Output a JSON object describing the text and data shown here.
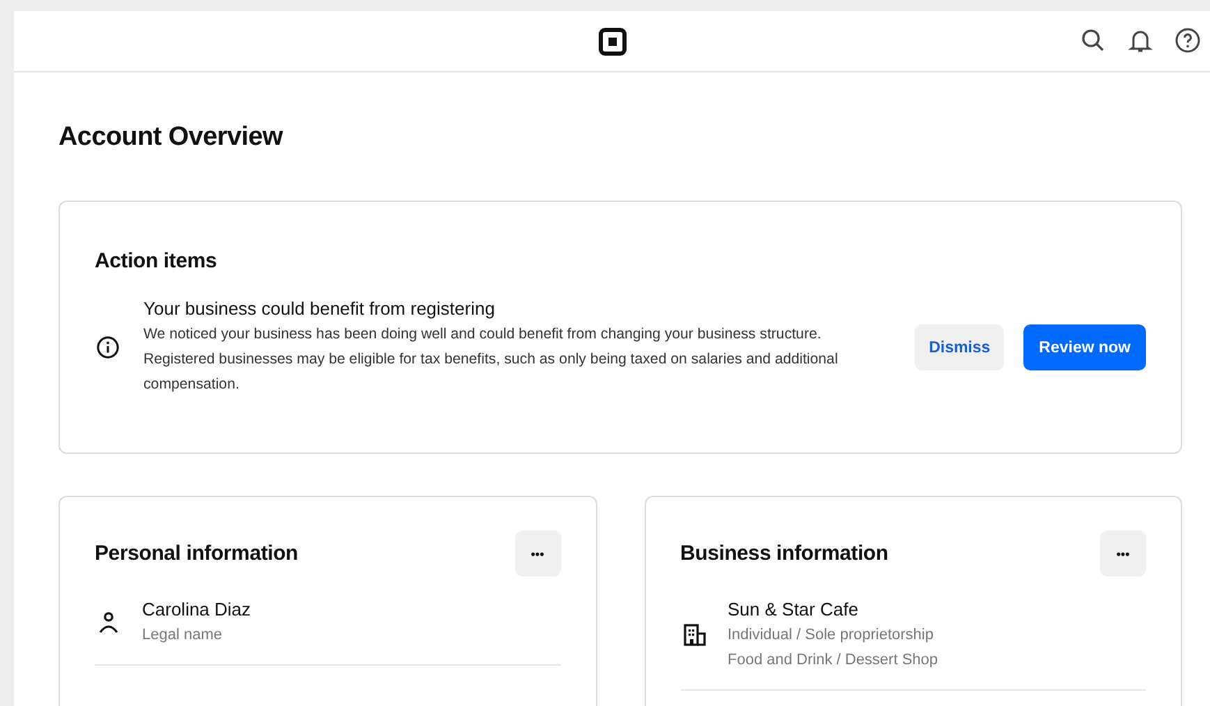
{
  "page": {
    "title": "Account Overview"
  },
  "action_items": {
    "title": "Action items",
    "items": [
      {
        "title": "Your business could benefit from registering",
        "body": "We noticed your business has been doing well and could benefit from changing your business structure. Registered businesses may be eligible for tax benefits, such as only being taxed on salaries and additional compensation.",
        "buttons": [
          {
            "label": "Dismiss",
            "kind": "secondary"
          },
          {
            "label": "Review now",
            "kind": "primary"
          }
        ]
      }
    ]
  },
  "cards": [
    {
      "title": "Personal information",
      "menu": "•••",
      "rows": [
        {
          "kind": "person",
          "primary": "Carolina Diaz",
          "secondary": [
            "Legal name"
          ]
        }
      ]
    },
    {
      "title": "Business information",
      "menu": "•••",
      "rows": [
        {
          "kind": "building",
          "primary": "Sun & Star Cafe",
          "secondary": [
            "Individual / Sole proprietorship",
            "Food and Drink / Dessert Shop"
          ]
        }
      ]
    }
  ]
}
